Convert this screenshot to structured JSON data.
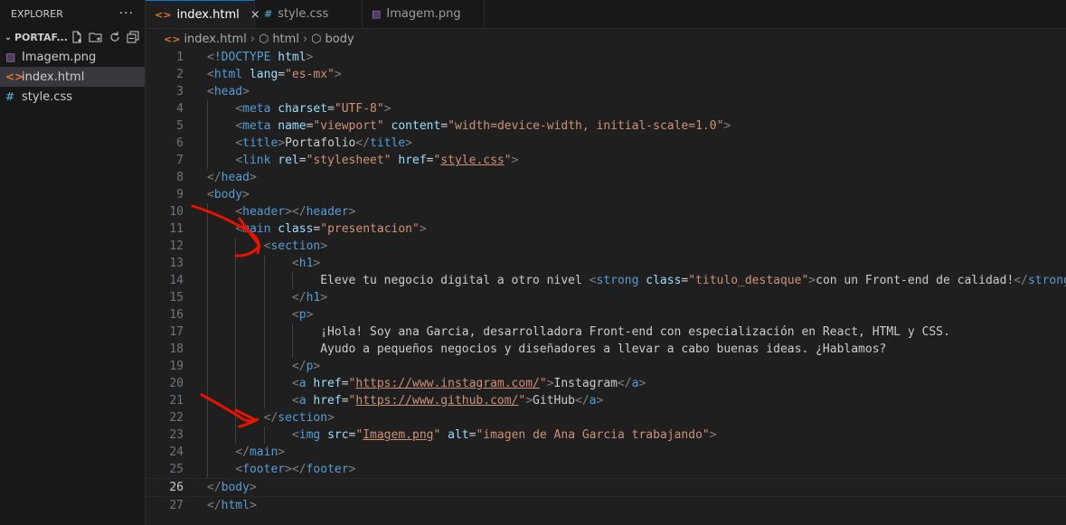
{
  "sidebar": {
    "title": "EXPLORER",
    "more": "···",
    "folder": "PORTAF...",
    "files": [
      {
        "name": "Imagem.png",
        "icon": "image-icon"
      },
      {
        "name": "index.html",
        "icon": "html-icon"
      },
      {
        "name": "style.css",
        "icon": "css-icon"
      }
    ]
  },
  "tabs": [
    {
      "label": "index.html",
      "close": "×"
    },
    {
      "label": "style.css"
    },
    {
      "label": "Imagem.png"
    }
  ],
  "breadcrumb": [
    "index.html",
    "html",
    "body"
  ],
  "editor": {
    "current_line": 26,
    "lines": [
      [
        [
          "b",
          "<"
        ],
        [
          "k",
          "!DOCTYPE"
        ],
        [
          "t",
          " "
        ],
        [
          "a",
          "html"
        ],
        [
          "b",
          ">"
        ]
      ],
      [
        [
          "b",
          "<"
        ],
        [
          "k",
          "html"
        ],
        [
          "t",
          " "
        ],
        [
          "a",
          "lang"
        ],
        [
          "e",
          "="
        ],
        [
          "v",
          "\"es-mx\""
        ],
        [
          "b",
          ">"
        ]
      ],
      [
        [
          "b",
          "<"
        ],
        [
          "k",
          "head"
        ],
        [
          "b",
          ">"
        ]
      ],
      [
        [
          "t",
          "    "
        ],
        [
          "b",
          "<"
        ],
        [
          "k",
          "meta"
        ],
        [
          "t",
          " "
        ],
        [
          "a",
          "charset"
        ],
        [
          "e",
          "="
        ],
        [
          "v",
          "\"UTF-8\""
        ],
        [
          "b",
          ">"
        ]
      ],
      [
        [
          "t",
          "    "
        ],
        [
          "b",
          "<"
        ],
        [
          "k",
          "meta"
        ],
        [
          "t",
          " "
        ],
        [
          "a",
          "name"
        ],
        [
          "e",
          "="
        ],
        [
          "v",
          "\"viewport\""
        ],
        [
          "t",
          " "
        ],
        [
          "a",
          "content"
        ],
        [
          "e",
          "="
        ],
        [
          "v",
          "\"width=device-width, initial-scale=1.0\""
        ],
        [
          "b",
          ">"
        ]
      ],
      [
        [
          "t",
          "    "
        ],
        [
          "b",
          "<"
        ],
        [
          "k",
          "title"
        ],
        [
          "b",
          ">"
        ],
        [
          "t",
          "Portafolio"
        ],
        [
          "b",
          "</"
        ],
        [
          "k",
          "title"
        ],
        [
          "b",
          ">"
        ]
      ],
      [
        [
          "t",
          "    "
        ],
        [
          "b",
          "<"
        ],
        [
          "k",
          "link"
        ],
        [
          "t",
          " "
        ],
        [
          "a",
          "rel"
        ],
        [
          "e",
          "="
        ],
        [
          "v",
          "\"stylesheet\""
        ],
        [
          "t",
          " "
        ],
        [
          "a",
          "href"
        ],
        [
          "e",
          "="
        ],
        [
          "v",
          "\""
        ],
        [
          "u",
          "style.css"
        ],
        [
          "v",
          "\""
        ],
        [
          "b",
          ">"
        ]
      ],
      [
        [
          "b",
          "</"
        ],
        [
          "k",
          "head"
        ],
        [
          "b",
          ">"
        ]
      ],
      [
        [
          "b",
          "<"
        ],
        [
          "k",
          "body"
        ],
        [
          "b",
          ">"
        ]
      ],
      [
        [
          "t",
          "    "
        ],
        [
          "b",
          "<"
        ],
        [
          "k",
          "header"
        ],
        [
          "b",
          "></"
        ],
        [
          "k",
          "header"
        ],
        [
          "b",
          ">"
        ]
      ],
      [
        [
          "t",
          "    "
        ],
        [
          "b",
          "<"
        ],
        [
          "k",
          "main"
        ],
        [
          "t",
          " "
        ],
        [
          "a",
          "class"
        ],
        [
          "e",
          "="
        ],
        [
          "v",
          "\"presentacion\""
        ],
        [
          "b",
          ">"
        ]
      ],
      [
        [
          "t",
          "        "
        ],
        [
          "b",
          "<"
        ],
        [
          "k",
          "section"
        ],
        [
          "b",
          ">"
        ]
      ],
      [
        [
          "t",
          "            "
        ],
        [
          "b",
          "<"
        ],
        [
          "k",
          "h1"
        ],
        [
          "b",
          ">"
        ]
      ],
      [
        [
          "t",
          "                Eleve tu negocio digital a otro nivel "
        ],
        [
          "b",
          "<"
        ],
        [
          "k",
          "strong"
        ],
        [
          "t",
          " "
        ],
        [
          "a",
          "class"
        ],
        [
          "e",
          "="
        ],
        [
          "v",
          "\"titulo_destaque\""
        ],
        [
          "b",
          ">"
        ],
        [
          "t",
          "con un Front-end de calidad!"
        ],
        [
          "b",
          "</"
        ],
        [
          "k",
          "strong"
        ],
        [
          "b",
          ">"
        ]
      ],
      [
        [
          "t",
          "            "
        ],
        [
          "b",
          "</"
        ],
        [
          "k",
          "h1"
        ],
        [
          "b",
          ">"
        ]
      ],
      [
        [
          "t",
          "            "
        ],
        [
          "b",
          "<"
        ],
        [
          "k",
          "p"
        ],
        [
          "b",
          ">"
        ]
      ],
      [
        [
          "t",
          "                ¡Hola! Soy ana Garcia, desarrolladora Front-end con especialización en React, HTML y CSS."
        ]
      ],
      [
        [
          "t",
          "                Ayudo a pequeños negocios y diseñadores a llevar a cabo buenas ideas. ¿Hablamos?"
        ]
      ],
      [
        [
          "t",
          "            "
        ],
        [
          "b",
          "</"
        ],
        [
          "k",
          "p"
        ],
        [
          "b",
          ">"
        ]
      ],
      [
        [
          "t",
          "            "
        ],
        [
          "b",
          "<"
        ],
        [
          "k",
          "a"
        ],
        [
          "t",
          " "
        ],
        [
          "a",
          "href"
        ],
        [
          "e",
          "="
        ],
        [
          "v",
          "\""
        ],
        [
          "u",
          "https://www.instagram.com/"
        ],
        [
          "v",
          "\""
        ],
        [
          "b",
          ">"
        ],
        [
          "t",
          "Instagram"
        ],
        [
          "b",
          "</"
        ],
        [
          "k",
          "a"
        ],
        [
          "b",
          ">"
        ]
      ],
      [
        [
          "t",
          "            "
        ],
        [
          "b",
          "<"
        ],
        [
          "k",
          "a"
        ],
        [
          "t",
          " "
        ],
        [
          "a",
          "href"
        ],
        [
          "e",
          "="
        ],
        [
          "v",
          "\""
        ],
        [
          "u",
          "https://www.github.com/"
        ],
        [
          "v",
          "\""
        ],
        [
          "b",
          ">"
        ],
        [
          "t",
          "GitHub"
        ],
        [
          "b",
          "</"
        ],
        [
          "k",
          "a"
        ],
        [
          "b",
          ">"
        ]
      ],
      [
        [
          "t",
          "        "
        ],
        [
          "b",
          "</"
        ],
        [
          "k",
          "section"
        ],
        [
          "b",
          ">"
        ]
      ],
      [
        [
          "t",
          "            "
        ],
        [
          "b",
          "<"
        ],
        [
          "k",
          "img"
        ],
        [
          "t",
          " "
        ],
        [
          "a",
          "src"
        ],
        [
          "e",
          "="
        ],
        [
          "v",
          "\""
        ],
        [
          "u",
          "Imagem.png"
        ],
        [
          "v",
          "\""
        ],
        [
          "t",
          " "
        ],
        [
          "a",
          "alt"
        ],
        [
          "e",
          "="
        ],
        [
          "v",
          "\"imagen de Ana Garcia trabajando\""
        ],
        [
          "b",
          ">"
        ]
      ],
      [
        [
          "t",
          "    "
        ],
        [
          "b",
          "</"
        ],
        [
          "k",
          "main"
        ],
        [
          "b",
          ">"
        ]
      ],
      [
        [
          "t",
          "    "
        ],
        [
          "b",
          "<"
        ],
        [
          "k",
          "footer"
        ],
        [
          "b",
          "></"
        ],
        [
          "k",
          "footer"
        ],
        [
          "b",
          ">"
        ]
      ],
      [
        [
          "b",
          "</"
        ],
        [
          "k",
          "body"
        ],
        [
          "b",
          ">"
        ]
      ],
      [
        [
          "b",
          "</"
        ],
        [
          "k",
          "html"
        ],
        [
          "b",
          ">"
        ]
      ]
    ]
  },
  "colors": {
    "tag": "#569cd6",
    "attribute": "#9cdcfe",
    "string": "#ce9178",
    "annotation": "#e51400"
  }
}
